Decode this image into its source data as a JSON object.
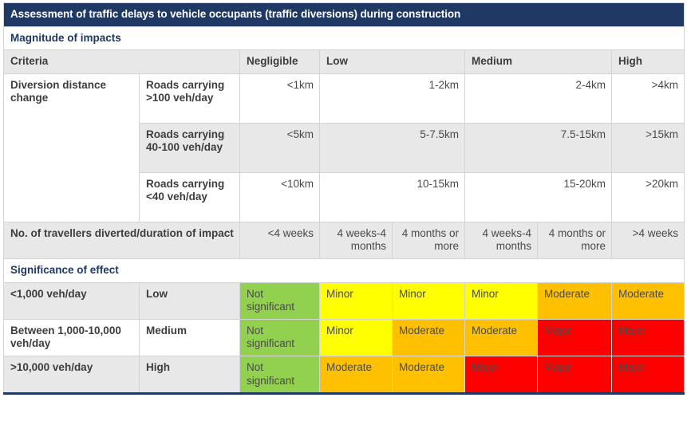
{
  "title": "Assessment of traffic delays to vehicle occupants (traffic diversions) during construction",
  "sections": {
    "magnitude": "Magnitude of impacts",
    "significance": "Significance of effect"
  },
  "columns": {
    "criteria": "Criteria",
    "negligible": "Negligible",
    "low": "Low",
    "medium": "Medium",
    "high": "High"
  },
  "magnitude_rows": [
    {
      "criteria": "Diversion distance change",
      "sub": "Roads carrying >100 veh/day",
      "negligible": "<1km",
      "low": "1-2km",
      "medium": "2-4km",
      "high": ">4km",
      "shaded": false
    },
    {
      "criteria": "",
      "sub": "Roads carrying 40-100 veh/day",
      "negligible": "<5km",
      "low": "5-7.5km",
      "medium": "7.5-15km",
      "high": ">15km",
      "shaded": true
    },
    {
      "criteria": "",
      "sub": "Roads carrying <40 veh/day",
      "negligible": "<10km",
      "low": "10-15km",
      "medium": "15-20km",
      "high": ">20km",
      "shaded": false
    }
  ],
  "travellers_row": {
    "criteria": "No. of travellers diverted/duration of impact",
    "negligible": "<4 weeks",
    "low_a": "4 weeks-4 months",
    "low_b": "4 months or more",
    "medium_a": "4 weeks-4 months",
    "medium_b": "4 months or more",
    "high": ">4 weeks",
    "shaded": true
  },
  "significance_rows": [
    {
      "traffic": "<1,000 veh/day",
      "sensitivity": "Low",
      "shaded": true,
      "cells": [
        {
          "label": "Not significant",
          "colour": "green"
        },
        {
          "label": "Minor",
          "colour": "yellow"
        },
        {
          "label": "Minor",
          "colour": "yellow"
        },
        {
          "label": "Minor",
          "colour": "yellow"
        },
        {
          "label": "Moderate",
          "colour": "orange"
        },
        {
          "label": "Moderate",
          "colour": "orange"
        }
      ]
    },
    {
      "traffic": "Between 1,000-10,000 veh/day",
      "sensitivity": "Medium",
      "shaded": false,
      "cells": [
        {
          "label": "Not significant",
          "colour": "green"
        },
        {
          "label": "Minor",
          "colour": "yellow"
        },
        {
          "label": "Moderate",
          "colour": "orange"
        },
        {
          "label": "Moderate",
          "colour": "orange"
        },
        {
          "label": "Major",
          "colour": "red"
        },
        {
          "label": "Major",
          "colour": "red"
        }
      ]
    },
    {
      "traffic": ">10,000 veh/day",
      "sensitivity": "High",
      "shaded": true,
      "cells": [
        {
          "label": "Not significant",
          "colour": "green"
        },
        {
          "label": "Moderate",
          "colour": "orange"
        },
        {
          "label": "Moderate",
          "colour": "orange"
        },
        {
          "label": "Major",
          "colour": "red"
        },
        {
          "label": "Major",
          "colour": "red"
        },
        {
          "label": "Major",
          "colour": "red"
        }
      ]
    }
  ],
  "colours": {
    "navy": "#1F3864",
    "green": "#92D050",
    "yellow": "#FFFF00",
    "orange": "#FFC000",
    "red": "#FF0000",
    "shade": "#e8e8e8"
  }
}
